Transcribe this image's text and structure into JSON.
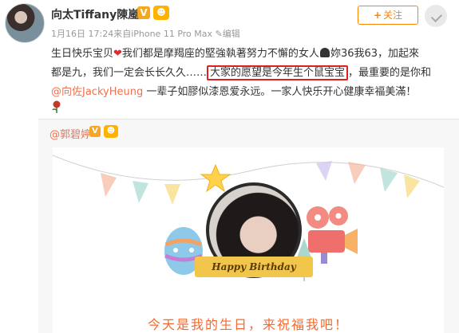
{
  "post": {
    "author": "向太Tiffany陳嵐",
    "verified_badge": "V",
    "level_badge": "☻",
    "meta": "1月16日 17:24来自iPhone 11 Pro Max ✎编辑",
    "follow_label": "关注",
    "follow_plus": "+",
    "text_line1_a": "生日快乐宝贝",
    "text_line1_heart": "❤",
    "text_line1_b": "我们都是摩羯座的堅強執著努力不懈的女人",
    "text_line1_c": "妳36我63，加起來",
    "text_line2_a": "都是九，我们一定会长长久久……",
    "text_line2_highlight": "大家的愿望是今年生个鼠宝宝",
    "text_line2_b": "，最重要的是你和",
    "text_line3_mention": "@向佐JackyHeung",
    "text_line3_b": " 一辈子如膠似漆恩爱永远。一家人快乐开心健康幸福美滿！",
    "rose_icon": "rose-icon"
  },
  "repost": {
    "author": "@郭碧婷",
    "verified_badge": "V",
    "level_badge": "☻",
    "banner_text": "Happy Birthday",
    "caption": "今天是我的生日，来祝福我吧！"
  },
  "colors": {
    "accent": "#ff8200",
    "mention": "#eb7350",
    "highlight_border": "#e02020",
    "caption": "#f26a2e"
  }
}
